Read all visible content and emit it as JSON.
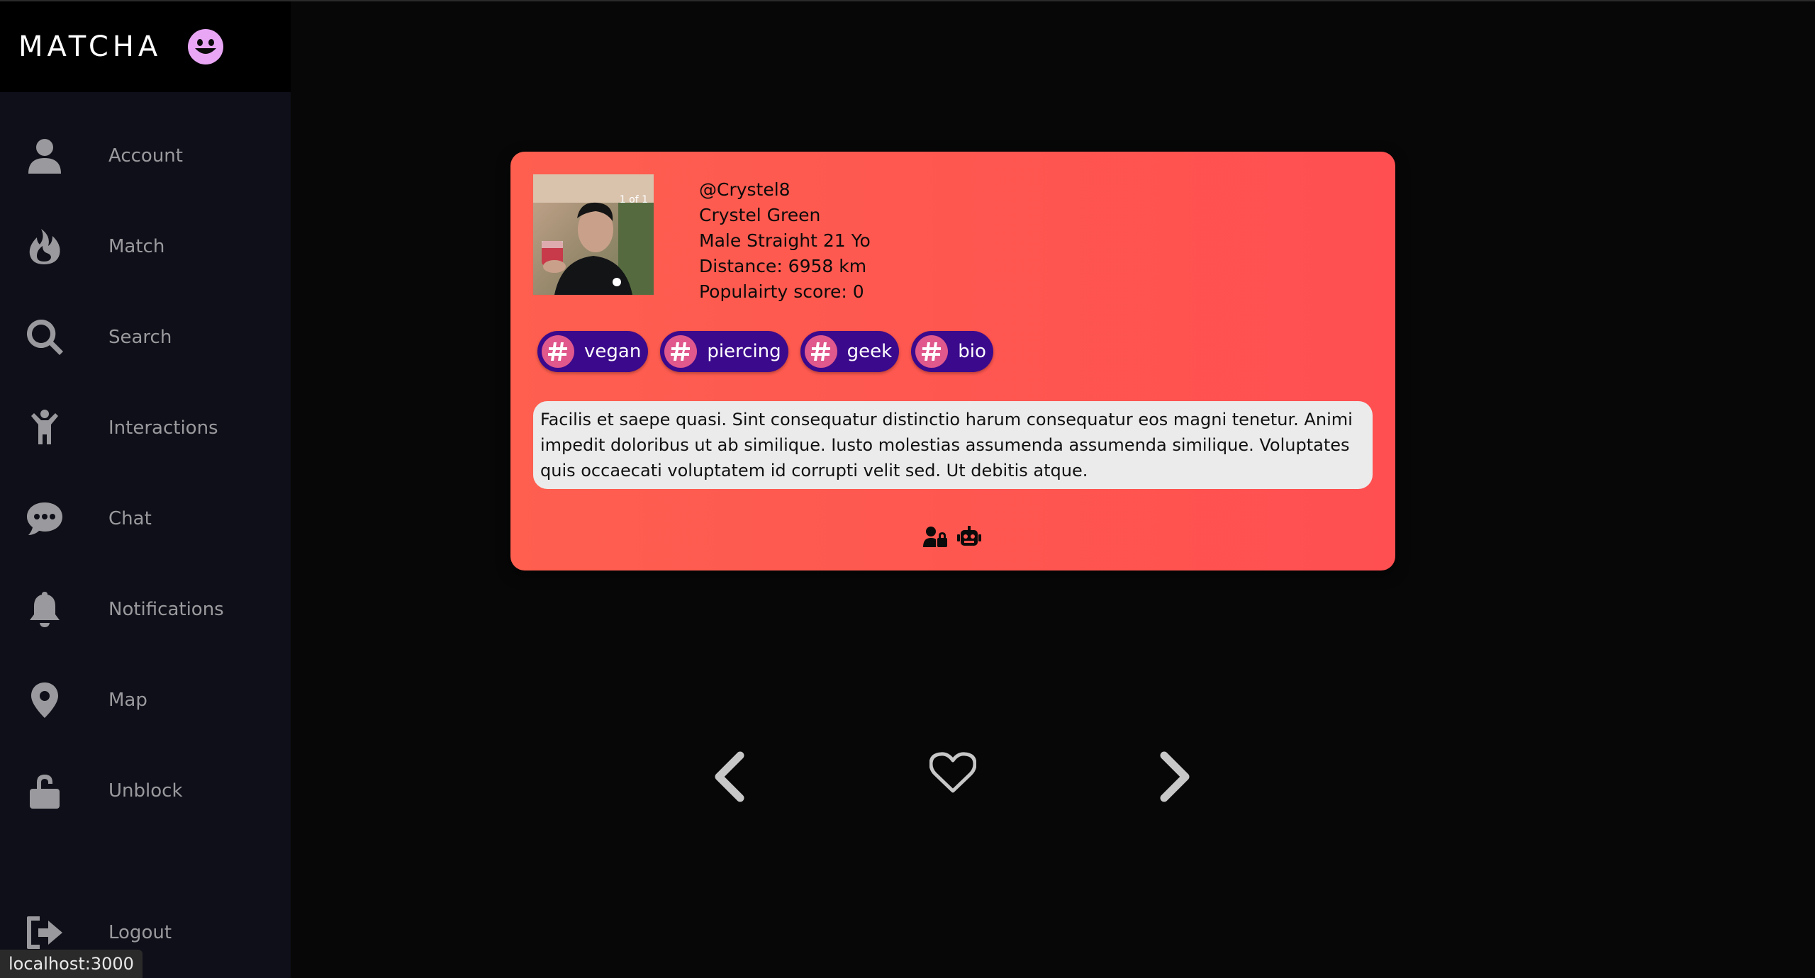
{
  "app": {
    "brand": "MATCHA",
    "logo_icon": "smiling-face-icon",
    "accent_color": "#e9a6f5"
  },
  "sidebar": {
    "items": [
      {
        "label": "Account",
        "icon": "user-icon"
      },
      {
        "label": "Match",
        "icon": "fire-icon"
      },
      {
        "label": "Search",
        "icon": "search-icon"
      },
      {
        "label": "Interactions",
        "icon": "child-icon"
      },
      {
        "label": "Chat",
        "icon": "comment-icon"
      },
      {
        "label": "Notifications",
        "icon": "bell-icon"
      },
      {
        "label": "Map",
        "icon": "map-marker-icon"
      },
      {
        "label": "Unblock",
        "icon": "unlock-icon"
      }
    ],
    "logout": {
      "label": "Logout",
      "icon": "sign-out-icon"
    }
  },
  "profile": {
    "photo_counter": "1 of 1",
    "username": "@Crystel8",
    "full_name": "Crystel Green",
    "details": "Male Straight 21 Yo",
    "distance": "Distance: 6958 km",
    "popularity": "Populairty score: 0",
    "tags": [
      {
        "label": "vegan"
      },
      {
        "label": "piercing"
      },
      {
        "label": "geek"
      },
      {
        "label": "bio"
      }
    ],
    "bio": "Facilis et saepe quasi. Sint consequatur distinctio harum consequatur eos magni tenetur. Animi impedit doloribus ut ab similique. Iusto molestias assumenda assumenda similique. Voluptates quis occaecati voluptatem id corrupti velit sed. Ut debitis atque.",
    "card_colors": [
      "#fe5f4f",
      "#ff4f51"
    ]
  },
  "actions": {
    "card_icons": [
      "user-lock-icon",
      "robot-icon"
    ],
    "bottom_icons": [
      "chevron-left-icon",
      "heart-outline-icon",
      "chevron-right-icon"
    ]
  },
  "status_bar": {
    "url": "localhost:3000"
  }
}
